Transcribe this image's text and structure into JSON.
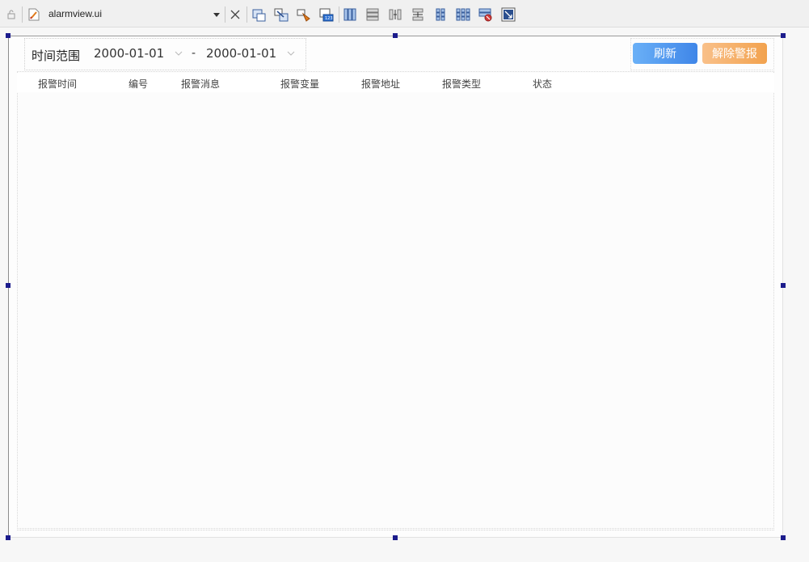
{
  "toolbar": {
    "filename": "alarmview.ui",
    "buttons": [
      "widget-edit-icon",
      "signal-slot-edit-icon",
      "buddy-edit-icon",
      "tab-order-edit-icon",
      "layout-horizontal-icon",
      "layout-vertical-icon",
      "layout-horizontal-splitter-icon",
      "layout-vertical-splitter-icon",
      "layout-form-icon",
      "layout-grid-icon",
      "break-layout-icon",
      "adjust-size-icon"
    ]
  },
  "filter": {
    "label": "时间范围",
    "start_date": "2000-01-01",
    "separator": "-",
    "end_date": "2000-01-01"
  },
  "actions": {
    "refresh_label": "刷新",
    "clear_alarm_label": "解除警报"
  },
  "table": {
    "columns": [
      "报警时间",
      "编号",
      "报警消息",
      "报警变量",
      "报警地址",
      "报警类型",
      "状态"
    ],
    "rows": []
  },
  "colors": {
    "refresh_start": "#6ab0f7",
    "refresh_end": "#3f86e8",
    "clear_start": "#f9c089",
    "clear_end": "#f2a24e",
    "selection_handle": "#1c1c8c"
  }
}
